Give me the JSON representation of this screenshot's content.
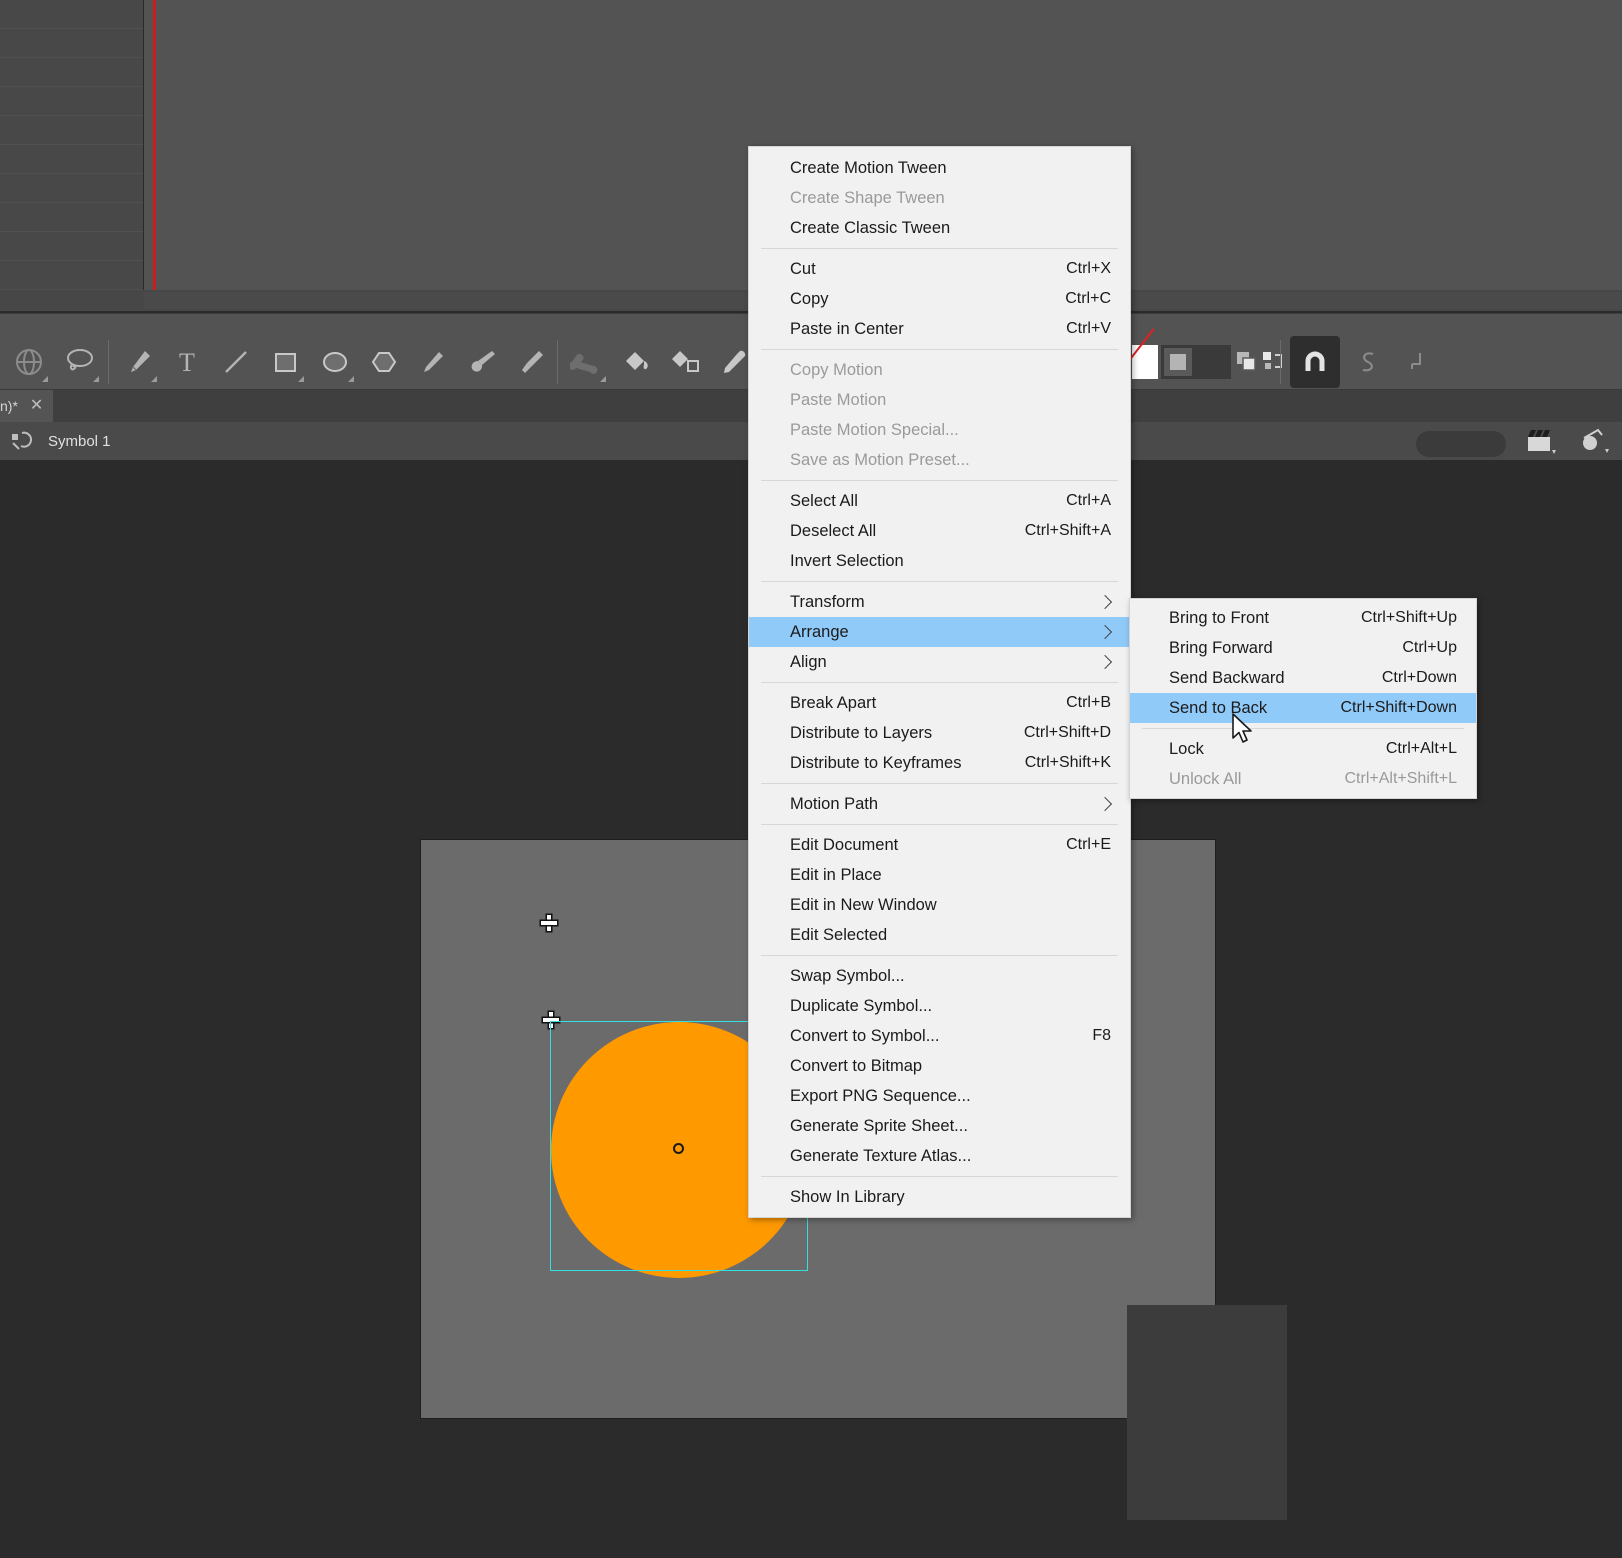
{
  "app": {
    "document_tab": {
      "label": "n)*",
      "close_icon": "close-icon"
    },
    "breadcrumb": {
      "icon": "edit-symbol-icon",
      "label": "Symbol 1"
    },
    "breadcrumb_right": {
      "scene_icon": "clapperboard-icon",
      "symbol_icon": "symbol-edit-icon"
    }
  },
  "toolbar": {
    "tools": [
      {
        "name": "3d-rotation-tool-icon",
        "has_flyout": true
      },
      {
        "name": "lasso-tool-icon",
        "has_flyout": true
      },
      {
        "name": "pen-tool-icon",
        "has_flyout": true
      },
      {
        "name": "text-tool-icon",
        "has_flyout": false
      },
      {
        "name": "line-tool-icon",
        "has_flyout": false
      },
      {
        "name": "rectangle-tool-icon",
        "has_flyout": true
      },
      {
        "name": "oval-tool-icon",
        "has_flyout": true
      },
      {
        "name": "polygon-tool-icon",
        "has_flyout": false
      },
      {
        "name": "pencil-tool-icon",
        "has_flyout": false
      },
      {
        "name": "paint-brush-tool-icon",
        "has_flyout": false
      },
      {
        "name": "brush-tool-icon",
        "has_flyout": false
      },
      {
        "name": "bone-tool-icon",
        "has_flyout": true
      },
      {
        "name": "paint-bucket-tool-icon",
        "has_flyout": false
      },
      {
        "name": "ink-bottle-tool-icon",
        "has_flyout": false
      },
      {
        "name": "eyedropper-tool-icon",
        "has_flyout": false
      }
    ],
    "options": [
      {
        "name": "stroke-color-swatch",
        "value": "none"
      },
      {
        "name": "fill-color-swatch",
        "value": "#5a5a5a"
      },
      {
        "name": "dark-swatch",
        "value": "#3a3a3a"
      },
      {
        "name": "swap-colors-icon"
      },
      {
        "name": "reset-colors-icon"
      },
      {
        "name": "snap-to-objects-icon",
        "active": true
      },
      {
        "name": "smooth-icon"
      },
      {
        "name": "straighten-icon"
      }
    ]
  },
  "context_menu": {
    "groups": [
      {
        "items": [
          {
            "label": "Create Motion Tween",
            "shortcut": "",
            "disabled": false,
            "submenu": false,
            "name": "menu-item-create-motion-tween"
          },
          {
            "label": "Create Shape Tween",
            "shortcut": "",
            "disabled": true,
            "submenu": false,
            "name": "menu-item-create-shape-tween"
          },
          {
            "label": "Create Classic Tween",
            "shortcut": "",
            "disabled": false,
            "submenu": false,
            "name": "menu-item-create-classic-tween"
          }
        ]
      },
      {
        "items": [
          {
            "label": "Cut",
            "shortcut": "Ctrl+X",
            "disabled": false,
            "submenu": false,
            "name": "menu-item-cut"
          },
          {
            "label": "Copy",
            "shortcut": "Ctrl+C",
            "disabled": false,
            "submenu": false,
            "name": "menu-item-copy"
          },
          {
            "label": "Paste in Center",
            "shortcut": "Ctrl+V",
            "disabled": false,
            "submenu": false,
            "name": "menu-item-paste-in-center"
          }
        ]
      },
      {
        "items": [
          {
            "label": "Copy Motion",
            "shortcut": "",
            "disabled": true,
            "submenu": false,
            "name": "menu-item-copy-motion"
          },
          {
            "label": "Paste Motion",
            "shortcut": "",
            "disabled": true,
            "submenu": false,
            "name": "menu-item-paste-motion"
          },
          {
            "label": "Paste Motion Special...",
            "shortcut": "",
            "disabled": true,
            "submenu": false,
            "name": "menu-item-paste-motion-special"
          },
          {
            "label": "Save as Motion Preset...",
            "shortcut": "",
            "disabled": true,
            "submenu": false,
            "name": "menu-item-save-as-motion-preset"
          }
        ]
      },
      {
        "items": [
          {
            "label": "Select All",
            "shortcut": "Ctrl+A",
            "disabled": false,
            "submenu": false,
            "name": "menu-item-select-all"
          },
          {
            "label": "Deselect All",
            "shortcut": "Ctrl+Shift+A",
            "disabled": false,
            "submenu": false,
            "name": "menu-item-deselect-all"
          },
          {
            "label": "Invert Selection",
            "shortcut": "",
            "disabled": false,
            "submenu": false,
            "name": "menu-item-invert-selection"
          }
        ]
      },
      {
        "items": [
          {
            "label": "Transform",
            "shortcut": "",
            "disabled": false,
            "submenu": true,
            "name": "menu-item-transform"
          },
          {
            "label": "Arrange",
            "shortcut": "",
            "disabled": false,
            "submenu": true,
            "highlighted": true,
            "name": "menu-item-arrange"
          },
          {
            "label": "Align",
            "shortcut": "",
            "disabled": false,
            "submenu": true,
            "name": "menu-item-align"
          }
        ]
      },
      {
        "items": [
          {
            "label": "Break Apart",
            "shortcut": "Ctrl+B",
            "disabled": false,
            "submenu": false,
            "name": "menu-item-break-apart"
          },
          {
            "label": "Distribute to Layers",
            "shortcut": "Ctrl+Shift+D",
            "disabled": false,
            "submenu": false,
            "name": "menu-item-distribute-to-layers"
          },
          {
            "label": "Distribute to Keyframes",
            "shortcut": "Ctrl+Shift+K",
            "disabled": false,
            "submenu": false,
            "name": "menu-item-distribute-to-keyframes"
          }
        ]
      },
      {
        "items": [
          {
            "label": "Motion Path",
            "shortcut": "",
            "disabled": false,
            "submenu": true,
            "name": "menu-item-motion-path"
          }
        ]
      },
      {
        "items": [
          {
            "label": "Edit Document",
            "shortcut": "Ctrl+E",
            "disabled": false,
            "submenu": false,
            "name": "menu-item-edit-document"
          },
          {
            "label": "Edit in Place",
            "shortcut": "",
            "disabled": false,
            "submenu": false,
            "name": "menu-item-edit-in-place"
          },
          {
            "label": "Edit in New Window",
            "shortcut": "",
            "disabled": false,
            "submenu": false,
            "name": "menu-item-edit-in-new-window"
          },
          {
            "label": "Edit Selected",
            "shortcut": "",
            "disabled": false,
            "submenu": false,
            "name": "menu-item-edit-selected"
          }
        ]
      },
      {
        "items": [
          {
            "label": "Swap Symbol...",
            "shortcut": "",
            "disabled": false,
            "submenu": false,
            "name": "menu-item-swap-symbol"
          },
          {
            "label": "Duplicate Symbol...",
            "shortcut": "",
            "disabled": false,
            "submenu": false,
            "name": "menu-item-duplicate-symbol"
          },
          {
            "label": "Convert to Symbol...",
            "shortcut": "F8",
            "disabled": false,
            "submenu": false,
            "name": "menu-item-convert-to-symbol"
          },
          {
            "label": "Convert to Bitmap",
            "shortcut": "",
            "disabled": false,
            "submenu": false,
            "name": "menu-item-convert-to-bitmap"
          },
          {
            "label": "Export PNG Sequence...",
            "shortcut": "",
            "disabled": false,
            "submenu": false,
            "name": "menu-item-export-png-sequence"
          },
          {
            "label": "Generate Sprite Sheet...",
            "shortcut": "",
            "disabled": false,
            "submenu": false,
            "name": "menu-item-generate-sprite-sheet"
          },
          {
            "label": "Generate Texture Atlas...",
            "shortcut": "",
            "disabled": false,
            "submenu": false,
            "name": "menu-item-generate-texture-atlas"
          }
        ]
      },
      {
        "items": [
          {
            "label": "Show In Library",
            "shortcut": "",
            "disabled": false,
            "submenu": false,
            "name": "menu-item-show-in-library"
          }
        ]
      }
    ]
  },
  "submenu": {
    "title": "Arrange",
    "groups": [
      {
        "items": [
          {
            "label": "Bring to Front",
            "shortcut": "Ctrl+Shift+Up",
            "disabled": false,
            "name": "submenu-item-bring-to-front"
          },
          {
            "label": "Bring Forward",
            "shortcut": "Ctrl+Up",
            "disabled": false,
            "name": "submenu-item-bring-forward"
          },
          {
            "label": "Send Backward",
            "shortcut": "Ctrl+Down",
            "disabled": false,
            "name": "submenu-item-send-backward"
          },
          {
            "label": "Send to Back",
            "shortcut": "Ctrl+Shift+Down",
            "disabled": false,
            "highlighted": true,
            "name": "submenu-item-send-to-back"
          }
        ]
      },
      {
        "items": [
          {
            "label": "Lock",
            "shortcut": "Ctrl+Alt+L",
            "disabled": false,
            "name": "submenu-item-lock"
          },
          {
            "label": "Unlock All",
            "shortcut": "Ctrl+Alt+Shift+L",
            "disabled": true,
            "name": "submenu-item-unlock-all"
          }
        ]
      }
    ]
  },
  "stage": {
    "shape": {
      "name": "orange-circle",
      "fill": "#ff9900",
      "selected": true
    },
    "selection_color": "#33e0e0",
    "playhead_color": "#c81e1e"
  }
}
